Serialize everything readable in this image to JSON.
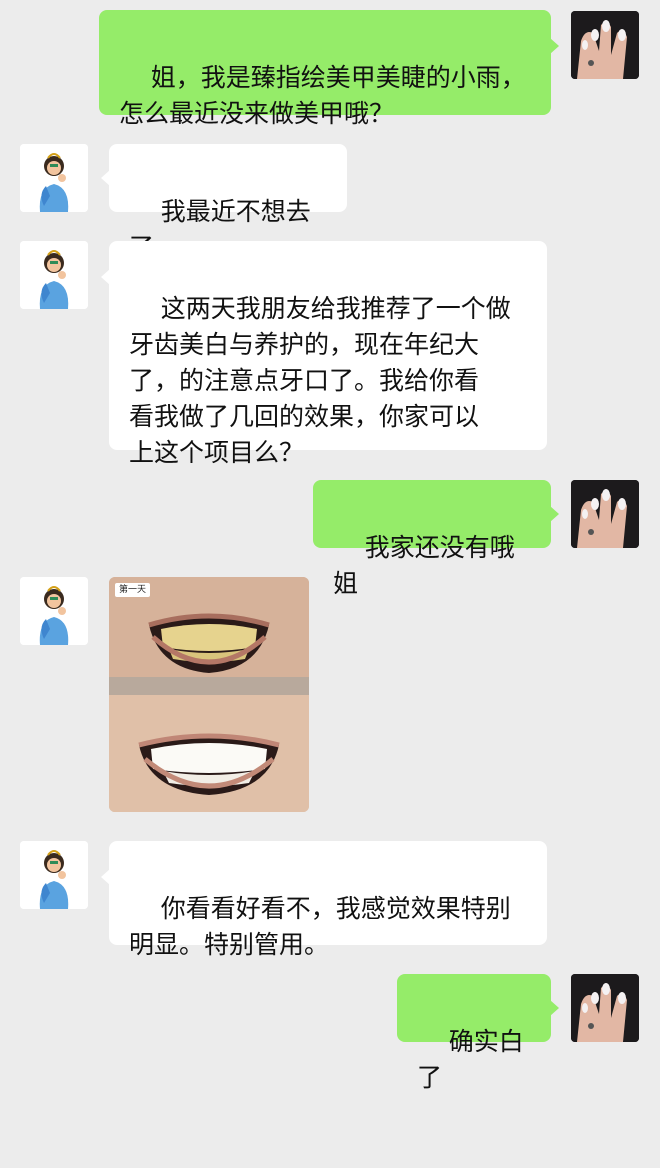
{
  "messages": [
    {
      "side": "right",
      "type": "text",
      "text": "姐，我是臻指绘美甲美睫的小雨，\n怎么最近没来做美甲哦？"
    },
    {
      "side": "left",
      "type": "text",
      "text": "我最近不想去了"
    },
    {
      "side": "left",
      "type": "text",
      "text": "这两天我朋友给我推荐了一个做\n牙齿美白与养护的，现在年纪大\n了，的注意点牙口了。我给你看\n看我做了几回的效果，你家可以\n上这个项目么？"
    },
    {
      "side": "right",
      "type": "text",
      "text": "我家还没有哦姐"
    },
    {
      "side": "left",
      "type": "image",
      "tag": "第一天",
      "icon": "teeth-before-after-photo"
    },
    {
      "side": "left",
      "type": "text",
      "text": "你看看好看不，我感觉效果特别\n明显。特别管用。"
    },
    {
      "side": "right",
      "type": "text",
      "text": "确实白了"
    }
  ],
  "avatars": {
    "left": {
      "icon": "cartoon-girl-avatar"
    },
    "right": {
      "icon": "manicured-hand-avatar"
    }
  },
  "colors": {
    "background": "#ececec",
    "incoming_bubble": "#ffffff",
    "outgoing_bubble": "#95ec69",
    "text": "#111111"
  }
}
